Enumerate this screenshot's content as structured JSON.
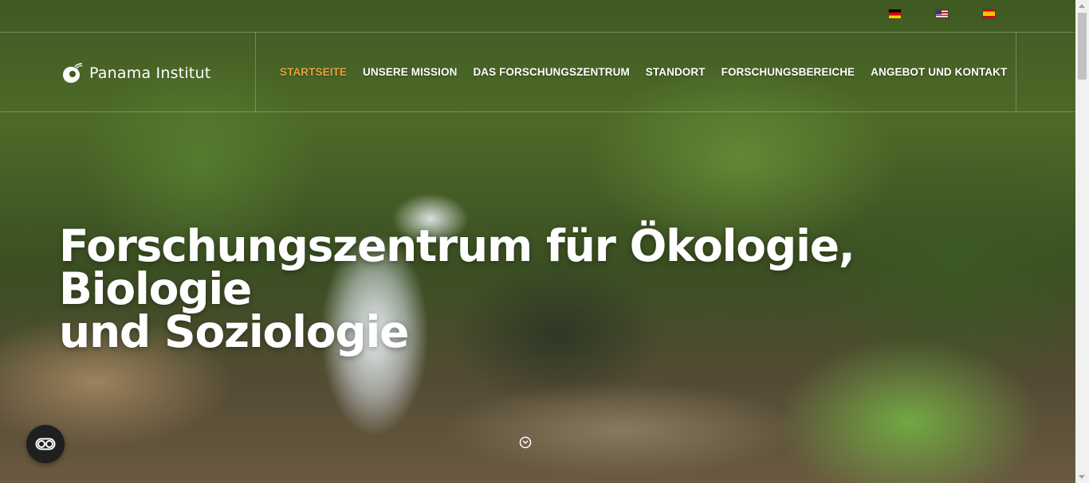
{
  "languages": [
    {
      "flag": "flag-de-icon"
    },
    {
      "flag": "flag-us-icon"
    },
    {
      "flag": "flag-es-icon"
    }
  ],
  "logo": {
    "text": "Panama Institut"
  },
  "nav": {
    "items": [
      {
        "label": "STARTSEITE",
        "active": true
      },
      {
        "label": "UNSERE MISSION"
      },
      {
        "label": "DAS FORSCHUNGSZENTRUM"
      },
      {
        "label": "STANDORT"
      },
      {
        "label": "FORSCHUNGSBEREICHE"
      },
      {
        "label": "ANGEBOT UND KONTAKT"
      }
    ]
  },
  "hero": {
    "headline_line1": "Forschungszentrum für Ökologie, Biologie",
    "headline_line2": "und Soziologie"
  },
  "colors": {
    "accent": "#e8a33c",
    "text": "#ffffff"
  }
}
